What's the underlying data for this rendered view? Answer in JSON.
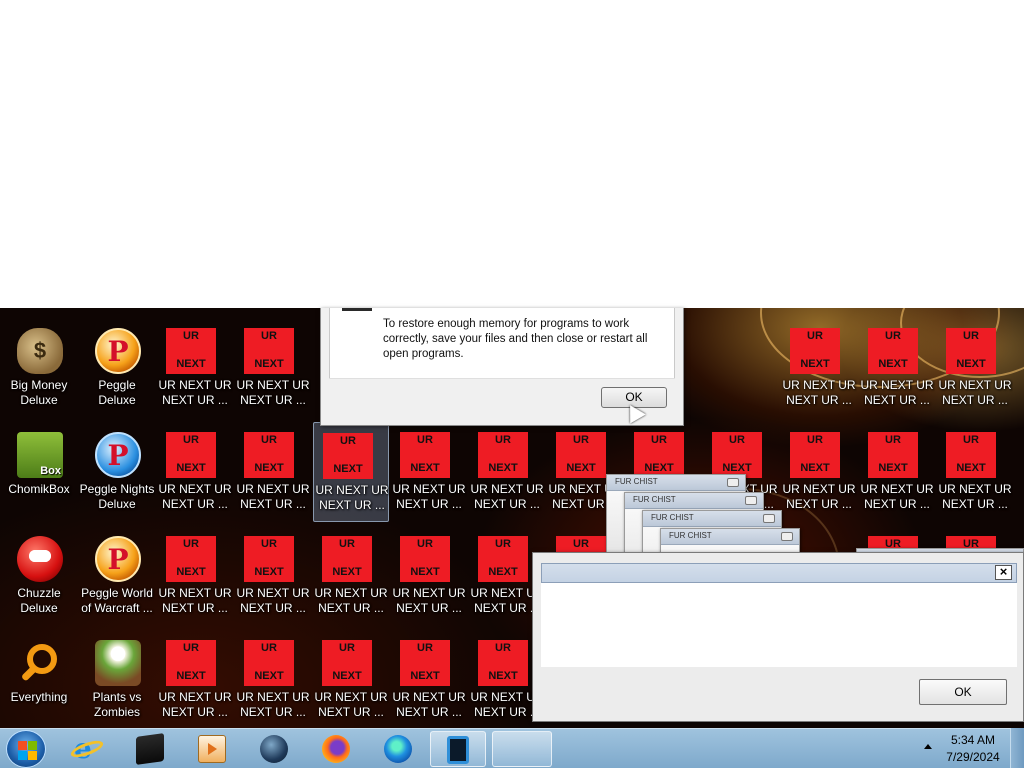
{
  "desktop_icons": {
    "big_money": "Big Money Deluxe",
    "peggle_deluxe": "Peggle Deluxe",
    "chomikbox": "ChomikBox",
    "peggle_nights": "Peggle Nights Deluxe",
    "chuzzle": "Chuzzle Deluxe",
    "peggle_world": "Peggle World of Warcraft ...",
    "everything": "Everything",
    "pvz": "Plants vs Zombies",
    "ur_next_label": "UR NEXT UR NEXT UR ...",
    "ur_next_tile_top": "UR",
    "ur_next_tile_bottom": "NEXT"
  },
  "memory_dialog": {
    "message": "To restore enough memory for programs to work correctly, save your files and then close or restart all open programs.",
    "ok_label": "OK"
  },
  "stacked_dialogs": {
    "title_fragment": "FUR CHIST"
  },
  "empty_dialog": {
    "close_glyph": "×",
    "ok_label": "OK"
  },
  "taskbar": {
    "time": "5:34 AM",
    "date": "7/29/2024"
  },
  "icons": {
    "start": "windows-start-icon",
    "ie": "internet-explorer-icon",
    "app1": "black-box-icon",
    "media": "media-player-icon",
    "globe": "globe-icon",
    "firefox": "firefox-icon",
    "edge": "edge-icon",
    "window1": "window-icon"
  },
  "colors": {
    "ur_tile": "#ee1c24",
    "taskbar": "#8fb5d4"
  }
}
